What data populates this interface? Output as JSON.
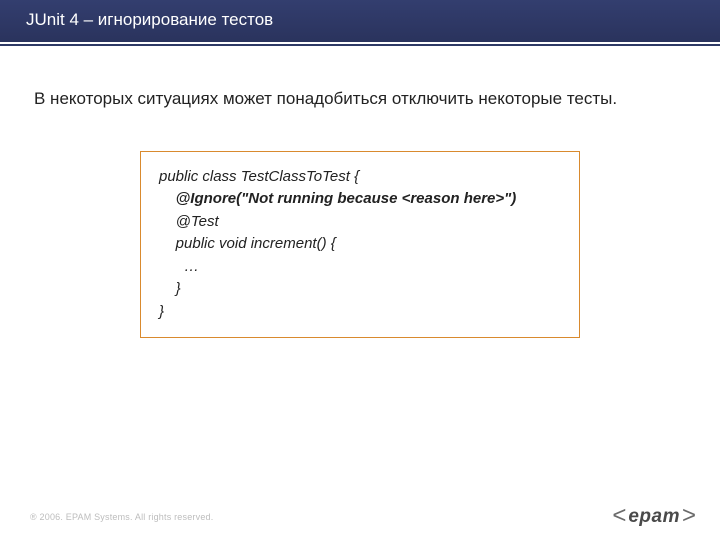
{
  "header": {
    "title": "JUnit 4 – игнорирование тестов"
  },
  "body": {
    "text": "В некоторых ситуациях может понадобиться отключить некоторые тесты."
  },
  "code": {
    "l1": "public class TestClassToTest {",
    "l2": "",
    "l3": "    @Ignore(\"Not running because <reason here>\")",
    "l4": "    @Test",
    "l5": "    public void increment() {",
    "l6": "      …",
    "l7": "    }",
    "l8": "}"
  },
  "footer": {
    "copyright": "® 2006. EPAM Systems. All rights reserved."
  },
  "logo": {
    "open": "<",
    "word": "epam",
    "close": ">"
  }
}
